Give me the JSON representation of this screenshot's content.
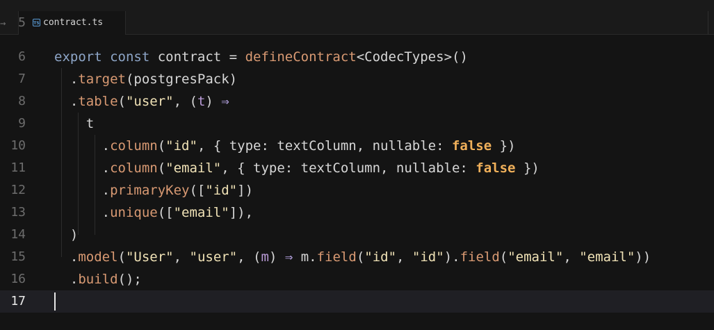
{
  "tab": {
    "back_glyph": "→",
    "icon_text": "TS",
    "label": "contract.ts"
  },
  "editor": {
    "partial_top_line": "5",
    "lines": [
      {
        "num": "6",
        "tokens": [
          {
            "t": "export",
            "c": "k"
          },
          {
            "t": " ",
            "c": "p"
          },
          {
            "t": "const",
            "c": "k"
          },
          {
            "t": " contract = ",
            "c": "p"
          },
          {
            "t": "defineContract",
            "c": "f"
          },
          {
            "t": "<CodecTypes>()",
            "c": "p"
          }
        ]
      },
      {
        "num": "7",
        "tokens": [
          {
            "t": "  .",
            "c": "p"
          },
          {
            "t": "target",
            "c": "f"
          },
          {
            "t": "(postgresPack)",
            "c": "p"
          }
        ]
      },
      {
        "num": "8",
        "tokens": [
          {
            "t": "  .",
            "c": "p"
          },
          {
            "t": "table",
            "c": "f"
          },
          {
            "t": "(",
            "c": "p"
          },
          {
            "t": "\"user\"",
            "c": "s"
          },
          {
            "t": ", (",
            "c": "p"
          },
          {
            "t": "t",
            "c": "par"
          },
          {
            "t": ") ",
            "c": "p"
          },
          {
            "t": "⇒",
            "c": "arr"
          }
        ]
      },
      {
        "num": "9",
        "tokens": [
          {
            "t": "    t",
            "c": "p"
          }
        ]
      },
      {
        "num": "10",
        "tokens": [
          {
            "t": "      .",
            "c": "p"
          },
          {
            "t": "column",
            "c": "f"
          },
          {
            "t": "(",
            "c": "p"
          },
          {
            "t": "\"id\"",
            "c": "s"
          },
          {
            "t": ", { type: textColumn, nullable: ",
            "c": "p"
          },
          {
            "t": "false",
            "c": "b"
          },
          {
            "t": " })",
            "c": "p"
          }
        ]
      },
      {
        "num": "11",
        "tokens": [
          {
            "t": "      .",
            "c": "p"
          },
          {
            "t": "column",
            "c": "f"
          },
          {
            "t": "(",
            "c": "p"
          },
          {
            "t": "\"email\"",
            "c": "s"
          },
          {
            "t": ", { type: textColumn, nullable: ",
            "c": "p"
          },
          {
            "t": "false",
            "c": "b"
          },
          {
            "t": " })",
            "c": "p"
          }
        ]
      },
      {
        "num": "12",
        "tokens": [
          {
            "t": "      .",
            "c": "p"
          },
          {
            "t": "primaryKey",
            "c": "f"
          },
          {
            "t": "([",
            "c": "p"
          },
          {
            "t": "\"id\"",
            "c": "s"
          },
          {
            "t": "])",
            "c": "p"
          }
        ]
      },
      {
        "num": "13",
        "tokens": [
          {
            "t": "      .",
            "c": "p"
          },
          {
            "t": "unique",
            "c": "f"
          },
          {
            "t": "([",
            "c": "p"
          },
          {
            "t": "\"email\"",
            "c": "s"
          },
          {
            "t": "]),",
            "c": "p"
          }
        ]
      },
      {
        "num": "14",
        "tokens": [
          {
            "t": "  )",
            "c": "p"
          }
        ]
      },
      {
        "num": "15",
        "tokens": [
          {
            "t": "  .",
            "c": "p"
          },
          {
            "t": "model",
            "c": "f"
          },
          {
            "t": "(",
            "c": "p"
          },
          {
            "t": "\"User\"",
            "c": "s"
          },
          {
            "t": ", ",
            "c": "p"
          },
          {
            "t": "\"user\"",
            "c": "s"
          },
          {
            "t": ", (",
            "c": "p"
          },
          {
            "t": "m",
            "c": "par"
          },
          {
            "t": ") ",
            "c": "p"
          },
          {
            "t": "⇒",
            "c": "arr"
          },
          {
            "t": " m.",
            "c": "p"
          },
          {
            "t": "field",
            "c": "f"
          },
          {
            "t": "(",
            "c": "p"
          },
          {
            "t": "\"id\"",
            "c": "s"
          },
          {
            "t": ", ",
            "c": "p"
          },
          {
            "t": "\"id\"",
            "c": "s"
          },
          {
            "t": ").",
            "c": "p"
          },
          {
            "t": "field",
            "c": "f"
          },
          {
            "t": "(",
            "c": "p"
          },
          {
            "t": "\"email\"",
            "c": "s"
          },
          {
            "t": ", ",
            "c": "p"
          },
          {
            "t": "\"email\"",
            "c": "s"
          },
          {
            "t": "))",
            "c": "p"
          }
        ]
      },
      {
        "num": "16",
        "tokens": [
          {
            "t": "  .",
            "c": "p"
          },
          {
            "t": "build",
            "c": "f"
          },
          {
            "t": "();",
            "c": "p"
          }
        ]
      },
      {
        "num": "17",
        "tokens": [],
        "active": true
      }
    ]
  },
  "colors": {
    "background": "#141414",
    "keyword": "#8ea6c8",
    "function": "#d99a73",
    "string": "#f0e2b6",
    "boolean": "#f0b05a",
    "active_line": "#1f1f24"
  }
}
